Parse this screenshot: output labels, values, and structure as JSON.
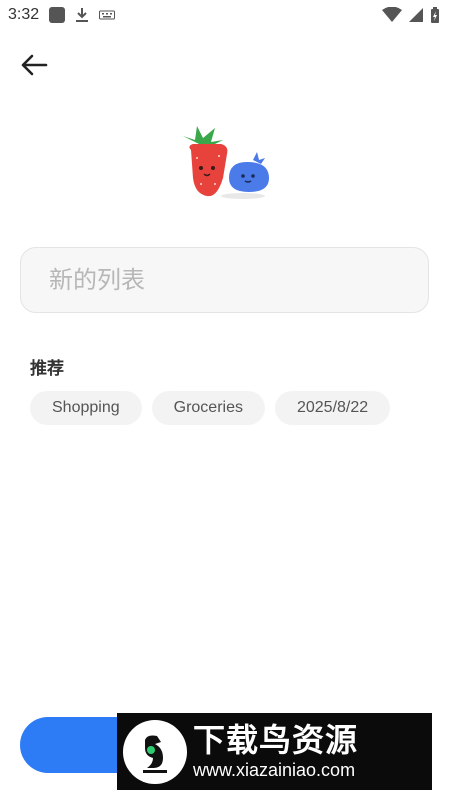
{
  "status_bar": {
    "time": "3:32",
    "left_icons": [
      "app-icon",
      "download-icon",
      "keyboard-icon"
    ],
    "right_icons": [
      "wifi-icon",
      "cellular-signal-icon",
      "battery-icon"
    ]
  },
  "header": {
    "back_icon": "arrow-left-icon"
  },
  "hero": {
    "icon": "strawberry-blueberry-illustration"
  },
  "list_name": {
    "value": "",
    "placeholder": "新的列表"
  },
  "suggestions": {
    "title": "推荐",
    "chips": [
      "Shopping",
      "Groceries",
      "2025/8/22"
    ]
  },
  "primary_button": {
    "color": "#2d7cf6"
  },
  "watermark": {
    "brand": "下载鸟资源",
    "url": "www.xiazainiao.com"
  },
  "colors": {
    "accent": "#2d7cf6",
    "input_bg": "#f7f7f7",
    "chip_bg": "#f3f3f3"
  }
}
